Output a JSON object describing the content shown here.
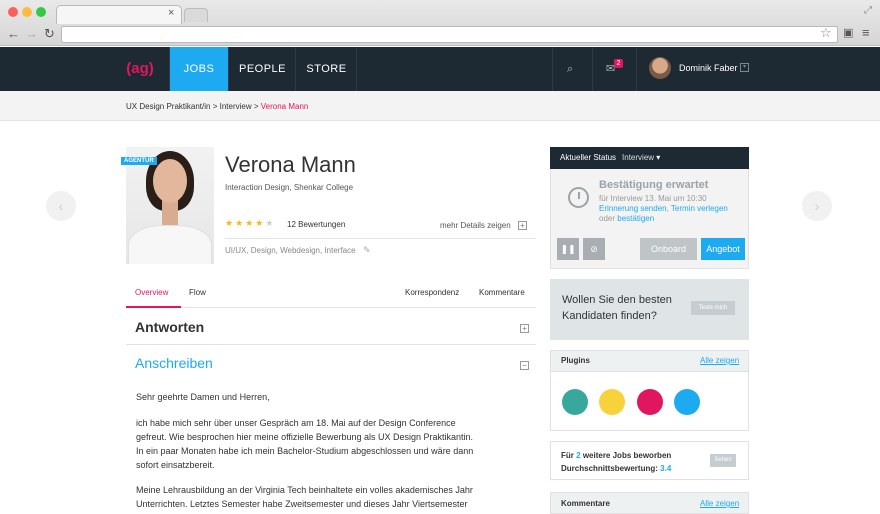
{
  "browser": {
    "tab_close": "×"
  },
  "nav": {
    "logo": "(ag)",
    "items": [
      {
        "label": "JOBS"
      },
      {
        "label": "PEOPLE"
      },
      {
        "label": "STORE"
      }
    ],
    "notifications_count": "2",
    "user_name": "Dominik Faber"
  },
  "breadcrumb": {
    "items": [
      "UX Design Praktikant/in",
      "Interview"
    ],
    "separator": " > ",
    "current": "Verona Mann"
  },
  "profile": {
    "badge": "AGENTUR",
    "name": "Verona Mann",
    "subtitle": "Interaction Design, Shenkar College",
    "rating": 4,
    "rating_max": 5,
    "reviews": "12 Bewertungen",
    "more_details": "mehr Details zeigen",
    "tags": "UI/UX, Design, Webdesign, Interface"
  },
  "tabs": {
    "overview": "Overview",
    "flow": "Flow",
    "korrespondenz": "Korrespondenz",
    "kommentare": "Kommentare"
  },
  "sections": {
    "antworten": "Antworten",
    "anschreiben": "Anschreiben"
  },
  "letter": {
    "greeting": "Sehr geehrte Damen und Herren,",
    "p1": [
      "ich habe mich sehr über unser Gespräch am 18. Mai auf der Design Conference",
      "gefreut. Wie besprochen hier meine offizielle Bewerbung als UX Design Praktikantin.",
      "In ein paar Monaten habe ich mein Bachelor-Studium abgeschlossen und wäre dann",
      "sofort einsatzbereit."
    ],
    "p2": [
      "Meine Lehrausbildung an der Virginia Tech beinhaltete ein volles akademisches Jahr",
      "Unterrichten. Letztes Semester habe Zweitsemester und dieses Jahr Viertsemester"
    ]
  },
  "status": {
    "label": "Aktueller Status",
    "value": "Interview",
    "title": "Bestätigung erwartet",
    "line1": "für Interview 13. Mai um 10:30",
    "link_reminder": "Erinnerung senden",
    "comma": ",",
    "link_reschedule": "Termin verlegen",
    "or": "oder",
    "link_confirm": "bestätigen",
    "btn_onboard": "Onboard",
    "btn_offer": "Angebot"
  },
  "promo": {
    "text": "Wollen Sie den besten Kandidaten finden?",
    "button": "Teste mich"
  },
  "plugins": {
    "title": "Plugins",
    "show_all": "Alle zeigen",
    "colors": [
      "#38a89d",
      "#f8d23a",
      "#e0165f",
      "#1eaaf1"
    ]
  },
  "jobs": {
    "prefix": "Für",
    "count": "2",
    "suffix": "weitere Jobs beworben",
    "avg_label": "Durchschnittsbewertung:",
    "avg_value": "3.4",
    "button": "Sehen"
  },
  "comments": {
    "title": "Kommentare",
    "show_all": "Alle zeigen"
  },
  "colors": {
    "accent": "#1eaaf1",
    "brand": "#e0165f",
    "navbar": "#1e2a33"
  }
}
